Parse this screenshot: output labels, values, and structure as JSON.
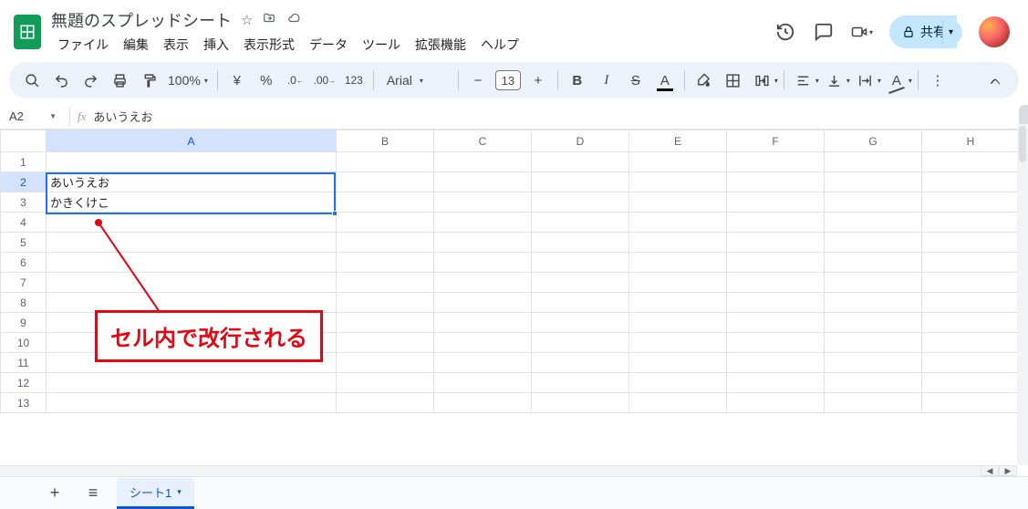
{
  "doc": {
    "title": "無題のスプレッドシート"
  },
  "menus": [
    "ファイル",
    "編集",
    "表示",
    "挿入",
    "表示形式",
    "データ",
    "ツール",
    "拡張機能",
    "ヘルプ"
  ],
  "share": {
    "label": "共有"
  },
  "toolbar": {
    "zoom": "100%",
    "font": "Arial",
    "font_size": "13",
    "currency": "¥",
    "percent": "%",
    "num_fmt": "123"
  },
  "name_box": "A2",
  "fx": "fx",
  "formula": "あいうえお",
  "columns": [
    "A",
    "B",
    "C",
    "D",
    "E",
    "F",
    "G",
    "H"
  ],
  "rows": [
    "1",
    "2",
    "3",
    "4",
    "5",
    "6",
    "7",
    "8",
    "9",
    "10",
    "11",
    "12",
    "13"
  ],
  "cells": {
    "A2": "あいうえお",
    "A3": "かきくけこ"
  },
  "callout": "セル内で改行される",
  "sheet_tab": "シート1"
}
